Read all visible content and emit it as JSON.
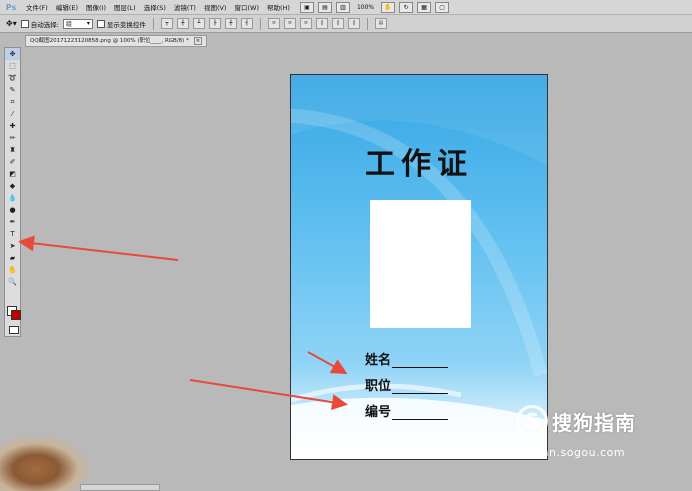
{
  "app": {
    "logo": "Ps"
  },
  "menu": [
    "文件(F)",
    "编辑(E)",
    "图像(I)",
    "图层(L)",
    "选择(S)",
    "滤镜(T)",
    "视图(V)",
    "窗口(W)",
    "帮助(H)"
  ],
  "menubar_tools": {
    "zoom": "100%"
  },
  "options": {
    "auto_select_label": "自动选择:",
    "auto_select_value": "组",
    "show_transform_label": "显示变换控件"
  },
  "document": {
    "tab_title": "QQ截图20171223120858.png @ 100% (职位____, RGB/8) *"
  },
  "card": {
    "title": "工作证",
    "fields": [
      "姓名",
      "职位",
      "编号"
    ]
  },
  "watermark": {
    "brand": "搜狗指南",
    "url": "zhinan.sogou.com"
  },
  "colors": {
    "foreground": "#c00000",
    "background": "#ffffff",
    "arrow": "#e84a3a"
  },
  "icons": [
    "move-tool-icon",
    "marquee-tool-icon",
    "lasso-tool-icon",
    "quick-select-icon",
    "crop-tool-icon",
    "eyedropper-icon",
    "healing-brush-icon",
    "brush-tool-icon",
    "clone-stamp-icon",
    "history-brush-icon",
    "eraser-icon",
    "paint-bucket-icon",
    "blur-tool-icon",
    "dodge-tool-icon",
    "pen-tool-icon",
    "type-tool-icon",
    "path-select-icon",
    "shape-tool-icon",
    "hand-tool-icon",
    "zoom-tool-icon"
  ]
}
